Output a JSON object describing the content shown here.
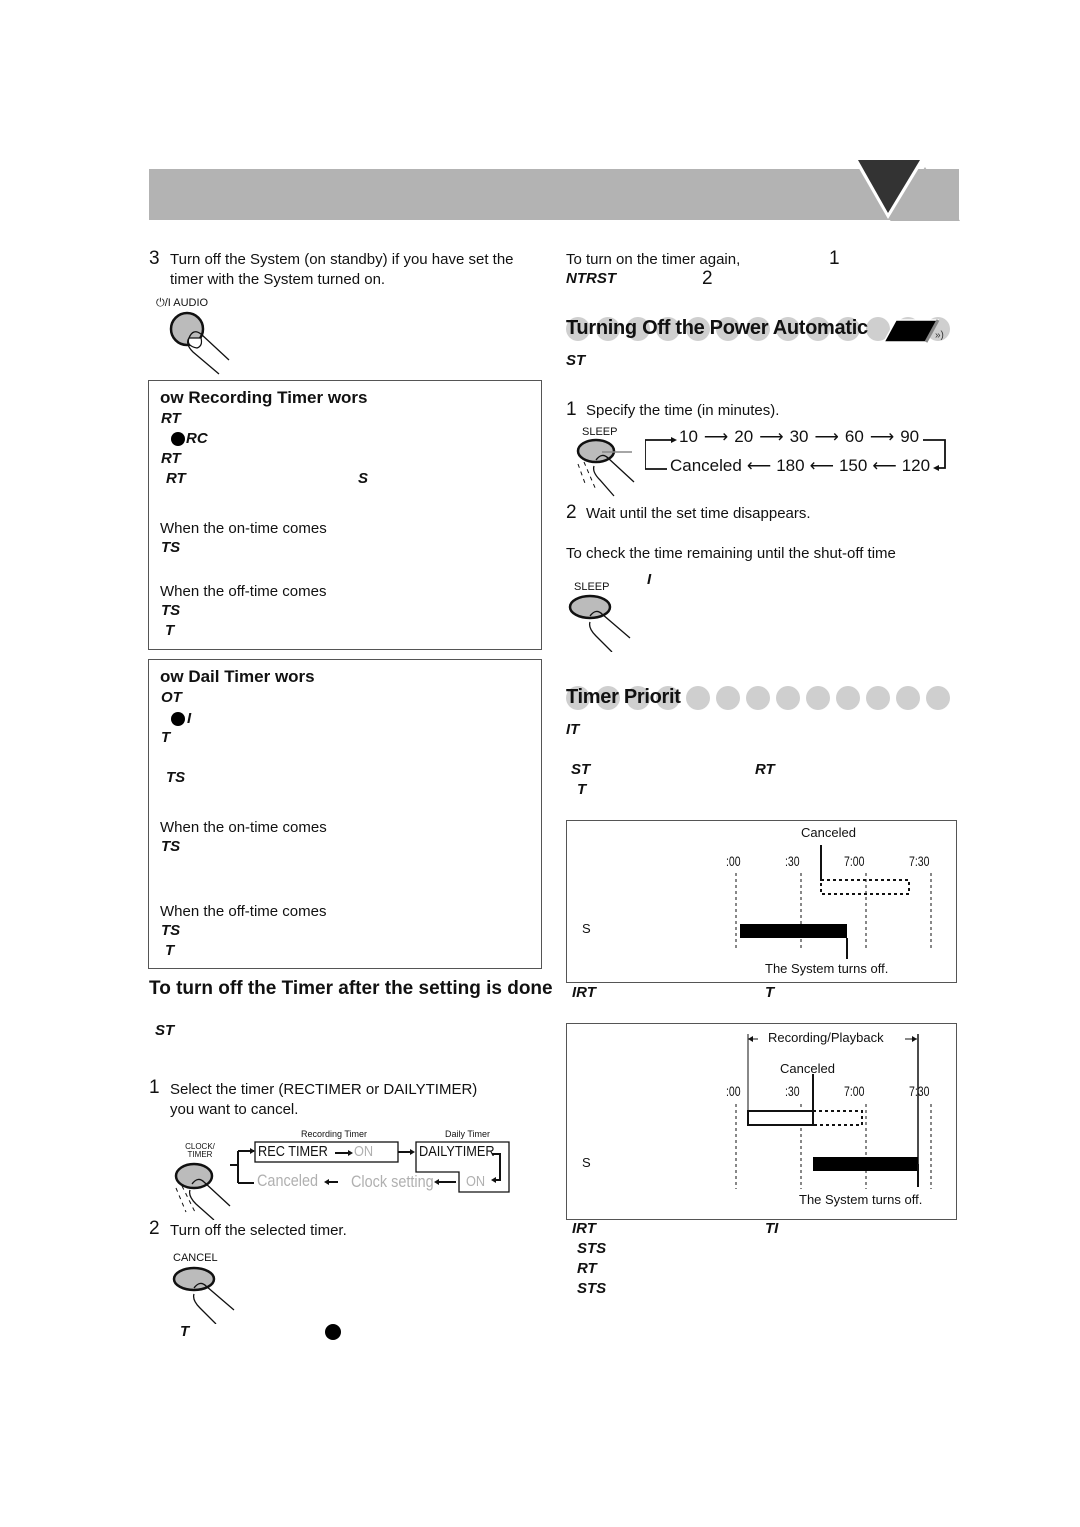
{
  "header": {
    "bar_color": "#b3b3b3",
    "triangle_color": "#333333"
  },
  "left": {
    "step3": {
      "num": "3",
      "text_line1": "Turn off the System (on standby) if you have set the",
      "text_line2": "timer with the System turned on.",
      "button_label": "⏻/I AUDIO"
    },
    "rec_box": {
      "title": "ow Recording Timer wors",
      "lines": [
        "RT",
        "RC",
        "RT",
        "RT",
        "S"
      ],
      "on_time_label": "When the on-time comes",
      "on_time_line": "TS",
      "off_time_label": "When the off-time comes",
      "off_time_lines": [
        "TS",
        "T"
      ]
    },
    "daily_box": {
      "title": "ow Dail Timer wors",
      "lines": [
        "OT",
        "I",
        "T",
        "TS"
      ],
      "on_time_label": "When the on-time comes",
      "on_time_line": "TS",
      "off_time_label": "When the off-time comes",
      "off_time_lines": [
        "TS",
        "T"
      ]
    },
    "turn_off": {
      "title": "To turn off the Timer after the setting is done",
      "sub": "ST",
      "step1_num": "1",
      "step1_line1": "Select the timer (RECTIMER or DAILYTIMER)",
      "step1_line2": "you want to cancel.",
      "diagram": {
        "button_label": "CLOCK/ TIMER",
        "rec_caption": "Recording Timer",
        "daily_caption": "Daily Timer",
        "rec_timer": "REC TIMER",
        "on1": "ON",
        "daily_timer": "DAILYTIMER",
        "on2": "ON",
        "clock_setting": "Clock setting",
        "canceled": "Canceled"
      },
      "step2_num": "2",
      "step2_text": "Turn off the selected timer.",
      "cancel_label": "CANCEL",
      "footer_line": "T"
    }
  },
  "right": {
    "turn_on_again": {
      "text": "To turn on the timer again,",
      "ref1": "1",
      "sub": "NTRST",
      "ref2": "2"
    },
    "sleep_section": {
      "title": "Turning Off the Power Automatic",
      "sub": "ST",
      "step1_num": "1",
      "step1_text": "Specify the time (in minutes).",
      "sleep_label": "SLEEP",
      "sequence_top": [
        "10",
        "20",
        "30",
        "60",
        "90"
      ],
      "sequence_bottom": [
        "Canceled",
        "180",
        "150",
        "120"
      ],
      "step2_num": "2",
      "step2_text": "Wait until the set time disappears.",
      "check_text": "To check the time remaining until the shut-off time",
      "check_sub": "I",
      "sleep_label2": "SLEEP"
    },
    "priority": {
      "title": "Timer Priorit",
      "lines": [
        "IT",
        "ST",
        "RT",
        "T"
      ],
      "diagram1": {
        "canceled": "Canceled",
        "ticks": [
          ":00",
          ":30",
          "7:00",
          "7:30"
        ],
        "row_label": "S",
        "turns_off": "The System turns off."
      },
      "between": [
        "IRT",
        "T"
      ],
      "diagram2": {
        "span_label": "Recording/Playback",
        "canceled": "Canceled",
        "ticks": [
          ":00",
          ":30",
          "7:00",
          "7:30"
        ],
        "row_label": "S",
        "turns_off": "The System turns off."
      },
      "footer": [
        "IRT",
        "TI",
        "STS",
        "RT",
        "STS"
      ]
    }
  }
}
